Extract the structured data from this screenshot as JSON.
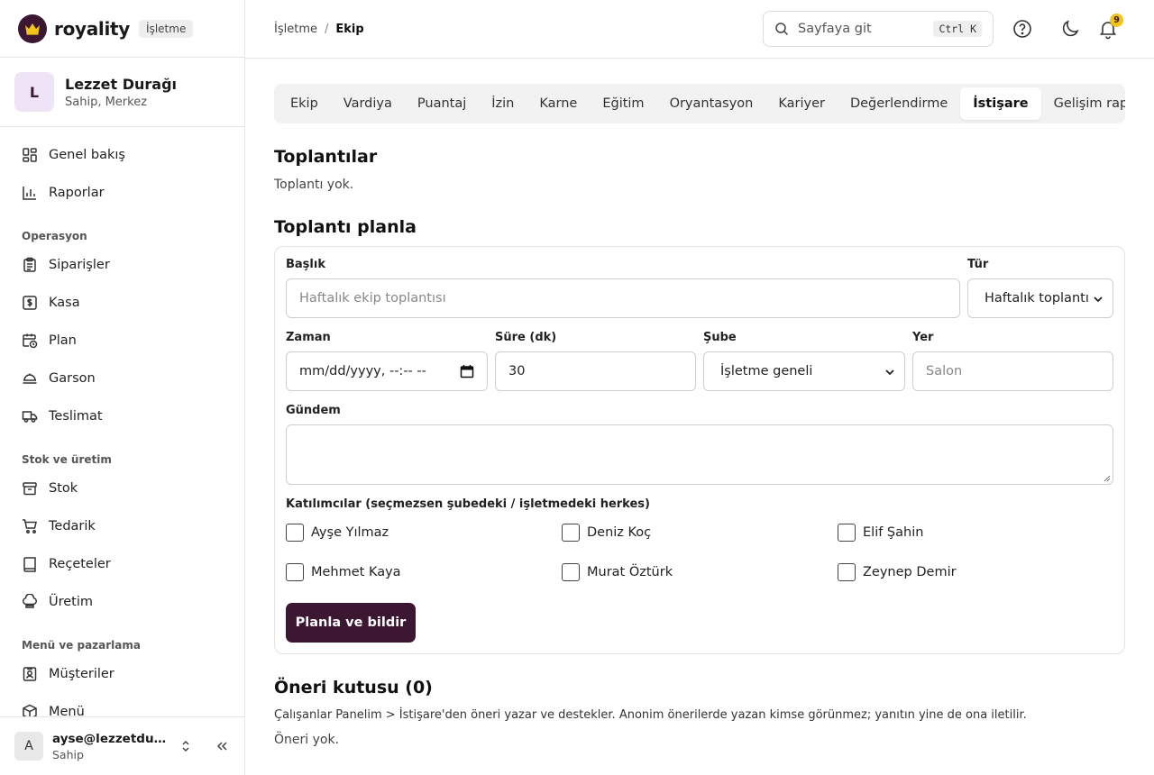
{
  "brand": {
    "name": "royality",
    "badge": "İşletme"
  },
  "org": {
    "initial": "L",
    "name": "Lezzet Durağı",
    "subtitle": "Sahip, Merkez"
  },
  "nav": {
    "top": [
      {
        "label": "Genel bakış",
        "icon": "grid-icon"
      },
      {
        "label": "Raporlar",
        "icon": "bar-chart-icon"
      }
    ],
    "sections": [
      {
        "title": "Operasyon",
        "items": [
          {
            "label": "Siparişler",
            "icon": "clipboard-icon"
          },
          {
            "label": "Kasa",
            "icon": "cash-icon"
          },
          {
            "label": "Plan",
            "icon": "calendar-clock-icon"
          },
          {
            "label": "Garson",
            "icon": "waiter-icon"
          },
          {
            "label": "Teslimat",
            "icon": "truck-icon"
          }
        ]
      },
      {
        "title": "Stok ve üretim",
        "items": [
          {
            "label": "Stok",
            "icon": "box-icon"
          },
          {
            "label": "Tedarik",
            "icon": "cart-icon"
          },
          {
            "label": "Reçeteler",
            "icon": "book-icon"
          },
          {
            "label": "Üretim",
            "icon": "chef-hat-icon"
          }
        ]
      },
      {
        "title": "Menü ve pazarlama",
        "items": [
          {
            "label": "Müşteriler",
            "icon": "id-card-icon"
          },
          {
            "label": "Menü",
            "icon": "package-icon"
          }
        ]
      }
    ]
  },
  "user": {
    "initial": "A",
    "email": "ayse@lezzetduragi.com",
    "role": "Sahip"
  },
  "topbar": {
    "breadcrumb": [
      "İşletme",
      "Ekip"
    ],
    "breadcrumb_sep": "/",
    "search_placeholder": "Sayfaya git",
    "search_shortcut": "Ctrl K",
    "notification_count": "9"
  },
  "tabs": [
    {
      "label": "Ekip",
      "active": false
    },
    {
      "label": "Vardiya",
      "active": false
    },
    {
      "label": "Puantaj",
      "active": false
    },
    {
      "label": "İzin",
      "active": false
    },
    {
      "label": "Karne",
      "active": false
    },
    {
      "label": "Eğitim",
      "active": false
    },
    {
      "label": "Oryantasyon",
      "active": false
    },
    {
      "label": "Kariyer",
      "active": false
    },
    {
      "label": "Değerlendirme",
      "active": false
    },
    {
      "label": "İstişare",
      "active": true
    },
    {
      "label": "Gelişim raporu",
      "active": false
    }
  ],
  "meetings": {
    "title": "Toplantılar",
    "empty": "Toplantı yok."
  },
  "plan": {
    "title": "Toplantı planla",
    "title_label": "Başlık",
    "title_placeholder": "Haftalık ekip toplantısı",
    "type_label": "Tür",
    "type_value": "Haftalık toplantı",
    "time_label": "Zaman",
    "time_value": "mm/dd/yyyy, --:-- --",
    "duration_label": "Süre (dk)",
    "duration_value": "30",
    "branch_label": "Şube",
    "branch_value": "İşletme geneli",
    "place_label": "Yer",
    "place_placeholder": "Salon",
    "agenda_label": "Gündem",
    "agenda_value": "",
    "participants_label": "Katılımcılar (seçmezsen şubedeki / işletmedeki herkes)",
    "participants": [
      {
        "name": "Ayşe Yılmaz",
        "checked": false
      },
      {
        "name": "Deniz Koç",
        "checked": false
      },
      {
        "name": "Elif Şahin",
        "checked": false
      },
      {
        "name": "Mehmet Kaya",
        "checked": false
      },
      {
        "name": "Murat Öztürk",
        "checked": false
      },
      {
        "name": "Zeynep Demir",
        "checked": false
      }
    ],
    "submit": "Planla ve bildir"
  },
  "suggestions": {
    "title": "Öneri kutusu (0)",
    "description": "Çalışanlar Panelim > İstişare'den öneri yazar ve destekler. Anonim önerilerde yazan kimse görünmez; yanıtın yine de ona iletilir.",
    "empty": "Öneri yok."
  },
  "colors": {
    "brand": "#3b1732",
    "badge": "#f0c419"
  }
}
